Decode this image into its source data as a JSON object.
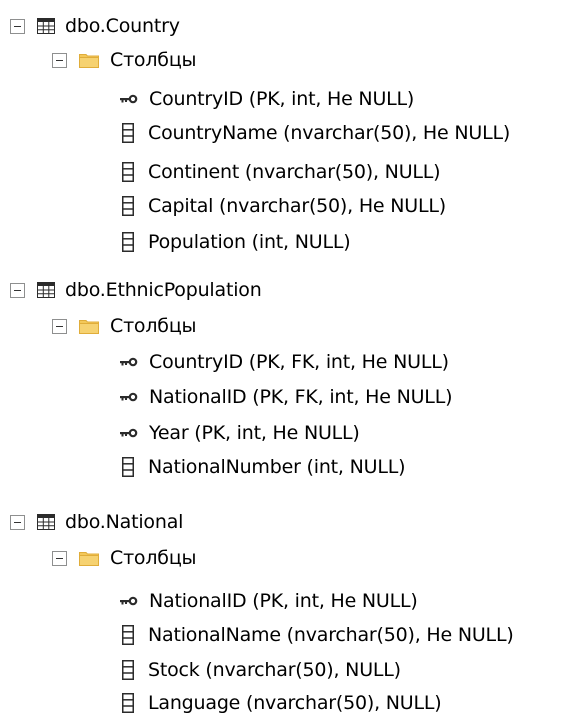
{
  "tree": {
    "tables": [
      {
        "name": "dbo.Country",
        "folder": "Столбцы",
        "columns": [
          {
            "label": "CountryID (PK, int, Не NULL)",
            "icon": "key-icon"
          },
          {
            "label": "CountryName (nvarchar(50), Не NULL)",
            "icon": "column-icon"
          },
          {
            "label": "Continent (nvarchar(50), NULL)",
            "icon": "column-icon"
          },
          {
            "label": "Capital (nvarchar(50), Не NULL)",
            "icon": "column-icon"
          },
          {
            "label": "Population (int, NULL)",
            "icon": "column-icon"
          }
        ]
      },
      {
        "name": "dbo.EthnicPopulation",
        "folder": "Столбцы",
        "columns": [
          {
            "label": "CountryID (PK, FK, int, Не NULL)",
            "icon": "key-icon"
          },
          {
            "label": "NationalID (PK, FK, int, Не NULL)",
            "icon": "key-icon"
          },
          {
            "label": "Year (PK, int, Не NULL)",
            "icon": "key-icon"
          },
          {
            "label": "NationalNumber (int, NULL)",
            "icon": "column-icon"
          }
        ]
      },
      {
        "name": "dbo.National",
        "folder": "Столбцы",
        "columns": [
          {
            "label": "NationalID (PK, int, Не NULL)",
            "icon": "key-icon"
          },
          {
            "label": "NationalName (nvarchar(50), Не NULL)",
            "icon": "column-icon"
          },
          {
            "label": "Stock (nvarchar(50), NULL)",
            "icon": "column-icon"
          },
          {
            "label": "Language (nvarchar(50), NULL)",
            "icon": "column-icon"
          }
        ]
      }
    ]
  },
  "colors": {
    "folder": "#f3c85a",
    "folder_dark": "#e0ad3a",
    "table_icon": "#2b2b2b",
    "key_icon": "#2b2b2b",
    "expander_border": "#8e8f8f"
  }
}
